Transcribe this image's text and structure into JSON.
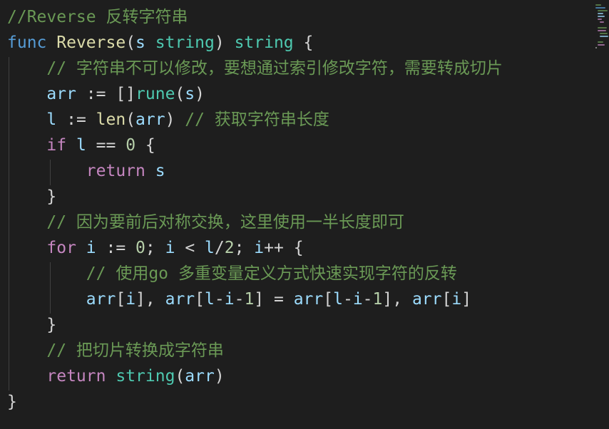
{
  "theme": {
    "background": "#1e1e1e",
    "default": "#d4d4d4",
    "comment": "#6a9955",
    "keyword": "#c586c0",
    "storage": "#569cd6",
    "function": "#dcdcaa",
    "type": "#4ec9b0",
    "variable": "#9cdcfe",
    "number": "#b5cea8"
  },
  "code_lines": [
    [
      {
        "text": "//Reverse 反转字符串",
        "kind": "comment"
      }
    ],
    [
      {
        "text": "func",
        "kind": "storage"
      },
      {
        "text": " ",
        "kind": "default"
      },
      {
        "text": "Reverse",
        "kind": "function"
      },
      {
        "text": "(",
        "kind": "default"
      },
      {
        "text": "s",
        "kind": "variable"
      },
      {
        "text": " ",
        "kind": "default"
      },
      {
        "text": "string",
        "kind": "type"
      },
      {
        "text": ") ",
        "kind": "default"
      },
      {
        "text": "string",
        "kind": "type"
      },
      {
        "text": " {",
        "kind": "default"
      }
    ],
    [
      {
        "text": "    ",
        "kind": "default"
      },
      {
        "text": "// 字符串不可以修改，要想通过索引修改字符，需要转成切片",
        "kind": "comment"
      }
    ],
    [
      {
        "text": "    ",
        "kind": "default"
      },
      {
        "text": "arr",
        "kind": "variable"
      },
      {
        "text": " := []",
        "kind": "default"
      },
      {
        "text": "rune",
        "kind": "type"
      },
      {
        "text": "(",
        "kind": "default"
      },
      {
        "text": "s",
        "kind": "variable"
      },
      {
        "text": ")",
        "kind": "default"
      }
    ],
    [
      {
        "text": "    ",
        "kind": "default"
      },
      {
        "text": "l",
        "kind": "variable"
      },
      {
        "text": " := ",
        "kind": "default"
      },
      {
        "text": "len",
        "kind": "function"
      },
      {
        "text": "(",
        "kind": "default"
      },
      {
        "text": "arr",
        "kind": "variable"
      },
      {
        "text": ") ",
        "kind": "default"
      },
      {
        "text": "// 获取字符串长度",
        "kind": "comment"
      }
    ],
    [
      {
        "text": "    ",
        "kind": "default"
      },
      {
        "text": "if",
        "kind": "keyword"
      },
      {
        "text": " ",
        "kind": "default"
      },
      {
        "text": "l",
        "kind": "variable"
      },
      {
        "text": " == ",
        "kind": "default"
      },
      {
        "text": "0",
        "kind": "number"
      },
      {
        "text": " {",
        "kind": "default"
      }
    ],
    [
      {
        "text": "        ",
        "kind": "default"
      },
      {
        "text": "return",
        "kind": "keyword"
      },
      {
        "text": " ",
        "kind": "default"
      },
      {
        "text": "s",
        "kind": "variable"
      }
    ],
    [
      {
        "text": "    }",
        "kind": "default"
      }
    ],
    [
      {
        "text": "    ",
        "kind": "default"
      },
      {
        "text": "// 因为要前后对称交换，这里使用一半长度即可",
        "kind": "comment"
      }
    ],
    [
      {
        "text": "    ",
        "kind": "default"
      },
      {
        "text": "for",
        "kind": "keyword"
      },
      {
        "text": " ",
        "kind": "default"
      },
      {
        "text": "i",
        "kind": "variable"
      },
      {
        "text": " := ",
        "kind": "default"
      },
      {
        "text": "0",
        "kind": "number"
      },
      {
        "text": "; ",
        "kind": "default"
      },
      {
        "text": "i",
        "kind": "variable"
      },
      {
        "text": " < ",
        "kind": "default"
      },
      {
        "text": "l",
        "kind": "variable"
      },
      {
        "text": "/",
        "kind": "default"
      },
      {
        "text": "2",
        "kind": "number"
      },
      {
        "text": "; ",
        "kind": "default"
      },
      {
        "text": "i",
        "kind": "variable"
      },
      {
        "text": "++ {",
        "kind": "default"
      }
    ],
    [
      {
        "text": "        ",
        "kind": "default"
      },
      {
        "text": "// 使用go 多重变量定义方式快速实现字符的反转",
        "kind": "comment"
      }
    ],
    [
      {
        "text": "        ",
        "kind": "default"
      },
      {
        "text": "arr",
        "kind": "variable"
      },
      {
        "text": "[",
        "kind": "default"
      },
      {
        "text": "i",
        "kind": "variable"
      },
      {
        "text": "], ",
        "kind": "default"
      },
      {
        "text": "arr",
        "kind": "variable"
      },
      {
        "text": "[",
        "kind": "default"
      },
      {
        "text": "l",
        "kind": "variable"
      },
      {
        "text": "-",
        "kind": "default"
      },
      {
        "text": "i",
        "kind": "variable"
      },
      {
        "text": "-",
        "kind": "default"
      },
      {
        "text": "1",
        "kind": "number"
      },
      {
        "text": "] = ",
        "kind": "default"
      },
      {
        "text": "arr",
        "kind": "variable"
      },
      {
        "text": "[",
        "kind": "default"
      },
      {
        "text": "l",
        "kind": "variable"
      },
      {
        "text": "-",
        "kind": "default"
      },
      {
        "text": "i",
        "kind": "variable"
      },
      {
        "text": "-",
        "kind": "default"
      },
      {
        "text": "1",
        "kind": "number"
      },
      {
        "text": "], ",
        "kind": "default"
      },
      {
        "text": "arr",
        "kind": "variable"
      },
      {
        "text": "[",
        "kind": "default"
      },
      {
        "text": "i",
        "kind": "variable"
      },
      {
        "text": "]",
        "kind": "default"
      }
    ],
    [
      {
        "text": "    }",
        "kind": "default"
      }
    ],
    [
      {
        "text": "    ",
        "kind": "default"
      },
      {
        "text": "// 把切片转换成字符串",
        "kind": "comment"
      }
    ],
    [
      {
        "text": "    ",
        "kind": "default"
      },
      {
        "text": "return",
        "kind": "keyword"
      },
      {
        "text": " ",
        "kind": "default"
      },
      {
        "text": "string",
        "kind": "type"
      },
      {
        "text": "(",
        "kind": "default"
      },
      {
        "text": "arr",
        "kind": "variable"
      },
      {
        "text": ")",
        "kind": "default"
      }
    ],
    [
      {
        "text": "}",
        "kind": "default"
      }
    ]
  ]
}
